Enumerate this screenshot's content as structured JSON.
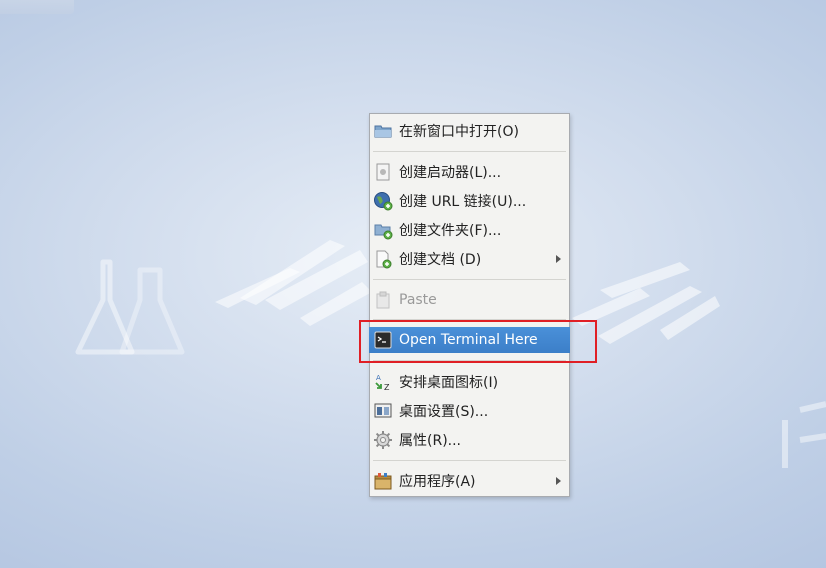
{
  "desktop": {
    "wallpaper_icons": [
      "flask-icon",
      "logo-watermark-icon",
      "people-icon"
    ]
  },
  "context_menu": {
    "items": [
      {
        "label": "在新窗口中打开(O)",
        "icon": "folder-icon",
        "enabled": true
      },
      {
        "label": "创建启动器(L)...",
        "icon": "launcher-icon",
        "enabled": true
      },
      {
        "label": "创建 URL 链接(U)...",
        "icon": "globe-link-icon",
        "enabled": true
      },
      {
        "label": "创建文件夹(F)...",
        "icon": "new-folder-icon",
        "enabled": true
      },
      {
        "label": "创建文档 (D)",
        "icon": "new-document-icon",
        "enabled": true,
        "submenu": true
      },
      {
        "label": "Paste",
        "icon": "paste-icon",
        "enabled": false
      },
      {
        "label": "Open Terminal Here",
        "icon": "terminal-icon",
        "enabled": true,
        "highlighted": true
      },
      {
        "label": "安排桌面图标(I)",
        "icon": "sort-icon",
        "enabled": true
      },
      {
        "label": "桌面设置(S)...",
        "icon": "desktop-settings-icon",
        "enabled": true
      },
      {
        "label": "属性(R)...",
        "icon": "gear-icon",
        "enabled": true
      },
      {
        "label": "应用程序(A)",
        "icon": "applications-icon",
        "enabled": true,
        "submenu": true
      }
    ]
  },
  "annotation": {
    "color": "#e01f25",
    "target": "Open Terminal Here"
  },
  "colors": {
    "menu_bg": "#f3f3f1",
    "selection": "#4a90d9"
  }
}
